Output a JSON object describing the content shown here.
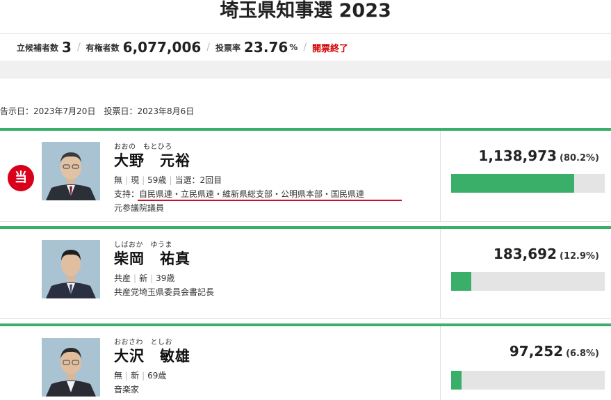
{
  "page": {
    "title": "埼玉県知事選 2023"
  },
  "stats": {
    "candidates_label": "立候補者数",
    "candidates_value": "3",
    "voters_label": "有権者数",
    "voters_value": "6,077,006",
    "turnout_label": "投票率",
    "turnout_value": "23.76",
    "turnout_unit": "%",
    "status": "開票終了",
    "separator": "/"
  },
  "dates": {
    "text": "告示日：2023年7月20日　投票日：2023年8月6日"
  },
  "candidates": [
    {
      "elected_badge": "当",
      "ruby": "おおの　もとひろ",
      "name": "大野　元裕",
      "party": "無",
      "status": "現",
      "age": "59歳",
      "times": "当選：2回目",
      "support": "支持：自民県連・立民県連・維新県総支部・公明県本部・国民県連",
      "career": "元参議院議員",
      "votes": "1,138,973",
      "percent_label": "(80.2%)",
      "share": 0.802
    },
    {
      "ruby": "しばおか　ゆうま",
      "name": "柴岡　祐真",
      "party": "共産",
      "status": "新",
      "age": "39歳",
      "career": "共産党埼玉県委員会書記長",
      "votes": "183,692",
      "percent_label": "(12.9%)",
      "share": 0.129
    },
    {
      "ruby": "おおさわ　としお",
      "name": "大沢　敏雄",
      "party": "無",
      "status": "新",
      "age": "69歳",
      "career": "音楽家",
      "votes": "97,252",
      "percent_label": "(6.8%)",
      "share": 0.068
    }
  ],
  "colors": {
    "accent_green": "#3aaf6a",
    "elected_red": "#d9001b",
    "status_red": "#d40000",
    "bar_background": "#e4e4e4"
  },
  "icons": {
    "elected_badge": "elected-badge-icon",
    "candidate_photo": "candidate-photo"
  }
}
